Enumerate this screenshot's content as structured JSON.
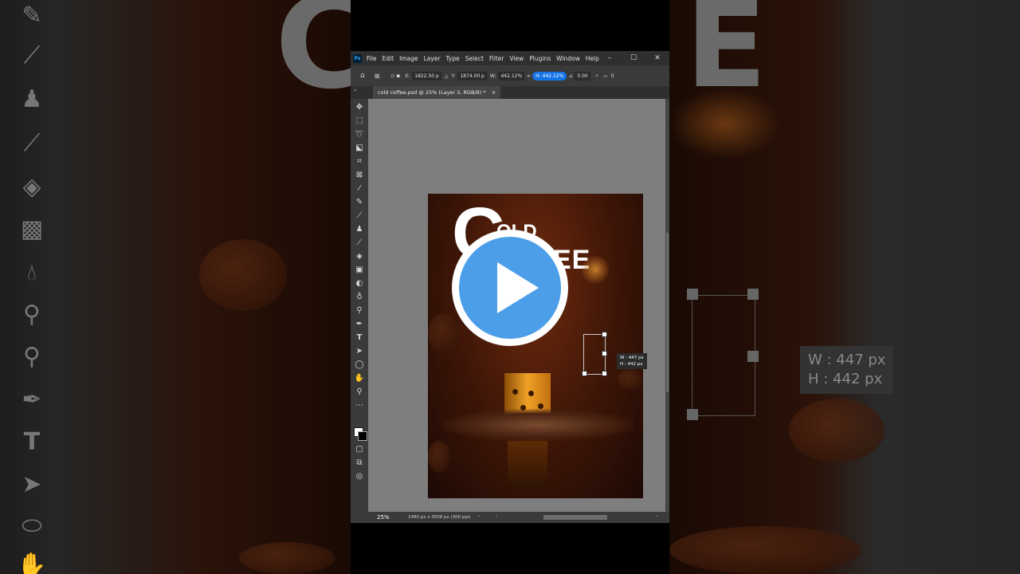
{
  "window": {
    "app_icon": "Ps",
    "menu": [
      "File",
      "Edit",
      "Image",
      "Layer",
      "Type",
      "Select",
      "Filter",
      "View",
      "Plugins",
      "Window",
      "Help"
    ],
    "controls": {
      "minimize": "–",
      "maximize": "☐",
      "close": "✕"
    }
  },
  "options_bar": {
    "x_label": "X:",
    "x_value": "1822.50 p",
    "y_label": "Y:",
    "y_value": "1874.00 p",
    "w_label": "W:",
    "w_value": "442.12%",
    "h_label": "H:",
    "h_value": "442.12%",
    "angle_value": "0.00",
    "trailing": "0"
  },
  "document_tab": {
    "title": "cold coffee.psd @ 25% (Layer 3, RGB/8) *",
    "close": "×"
  },
  "canvas": {
    "title_big_letter": "C",
    "title_line1": "OLD",
    "title_line2": "OFFEE"
  },
  "transform_tooltip": {
    "w": "W : 447 px",
    "h": "H : 442 px"
  },
  "background_tooltip": {
    "w": "W : 447 px",
    "h": "H : 442 px"
  },
  "background_letters": {
    "left": "C",
    "right": "E"
  },
  "status_bar": {
    "zoom": "25%",
    "doc_info": "2480 px x 3508 px (300 ppi)"
  },
  "colors": {
    "play_blue": "#4c9ee8",
    "ps_bg": "#535353",
    "highlight": "#1473e6"
  },
  "icons": [
    "move-icon",
    "marquee-icon",
    "lasso-icon",
    "object-select-icon",
    "crop-icon",
    "frame-icon",
    "eyedropper-icon",
    "healing-icon",
    "brush-icon",
    "stamp-icon",
    "history-brush-icon",
    "eraser-icon",
    "gradient-icon",
    "blur-icon",
    "dodge-icon",
    "pen-icon",
    "type-icon",
    "path-select-icon",
    "ellipse-icon",
    "hand-icon",
    "zoom-icon",
    "more-icon",
    "play-icon"
  ]
}
